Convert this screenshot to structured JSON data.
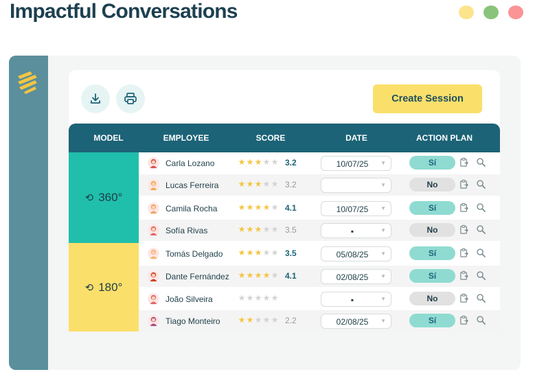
{
  "app": {
    "title": "Impactful Conversations",
    "window_dots": [
      "#fbe48b",
      "#8ac37b",
      "#fb9494"
    ]
  },
  "toolbar": {
    "download_icon": "download-icon",
    "print_icon": "printer-icon",
    "create_label": "Create Session"
  },
  "table": {
    "headers": [
      "MODEL",
      "EMPLOYEE",
      "SCORE",
      "DATE",
      "ACTION PLAN"
    ],
    "groups": [
      {
        "label": "360°",
        "icon": "feedback-loop-icon",
        "color": "#20bfab"
      },
      {
        "label": "180°",
        "icon": "feedback-loop-icon",
        "color": "#fbdf6b"
      }
    ],
    "rows": [
      {
        "name": "Carla Lozano",
        "stars": 3,
        "score": "3.2",
        "date": "10/07/25",
        "action": "Sí"
      },
      {
        "name": "Lucas Ferreira",
        "stars": 3,
        "score": "3.2",
        "date": "",
        "action": "No"
      },
      {
        "name": "Camila Rocha",
        "stars": 4,
        "score": "4.1",
        "date": "10/07/25",
        "action": "Sí"
      },
      {
        "name": "Sofía Rivas",
        "stars": 3,
        "score": "3.5",
        "date": "▪",
        "action": "No"
      },
      {
        "name": "Tomás Delgado",
        "stars": 3,
        "score": "3.5",
        "date": "05/08/25",
        "action": "Sí"
      },
      {
        "name": "Dante Fernández",
        "stars": 4,
        "score": "4.1",
        "date": "02/08/25",
        "action": "Sí"
      },
      {
        "name": "João Silveira",
        "stars": 0,
        "score": "",
        "date": "▪",
        "action": "No"
      },
      {
        "name": "Tiago Monteiro",
        "stars": 2,
        "score": "2.2",
        "date": "02/08/25",
        "action": "Sí"
      }
    ],
    "star_max": 5,
    "colors": {
      "star_on": "#f4c542",
      "star_off": "#d3d3d3",
      "header": "#1c6377"
    }
  }
}
